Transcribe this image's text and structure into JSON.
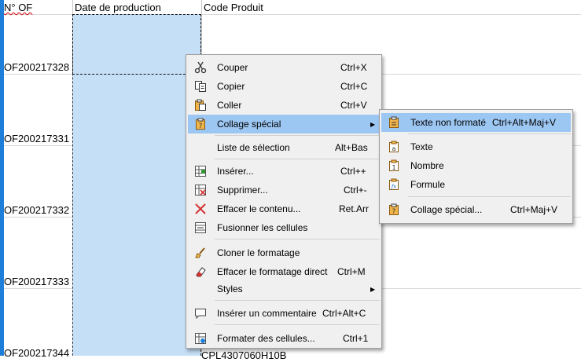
{
  "headers": {
    "of": "N° OF",
    "date": "Date de production",
    "code": "Code Produit"
  },
  "rows": [
    "OF200217328",
    "OF200217331",
    "OF200217332",
    "OF200217333",
    "OF200217344"
  ],
  "code_fragment": "CPL4307060H10B",
  "context_menu": {
    "cut": {
      "label": "Couper",
      "shortcut": "Ctrl+X"
    },
    "copy": {
      "label": "Copier",
      "shortcut": "Ctrl+C"
    },
    "paste": {
      "label": "Coller",
      "shortcut": "Ctrl+V"
    },
    "paste_special": {
      "label": "Collage spécial"
    },
    "selection_list": {
      "label": "Liste de sélection",
      "shortcut": "Alt+Bas"
    },
    "insert": {
      "label": "Insérer...",
      "shortcut": "Ctrl++"
    },
    "delete": {
      "label": "Supprimer...",
      "shortcut": "Ctrl+-"
    },
    "clear": {
      "label": "Effacer le contenu...",
      "shortcut": "Ret.Arr"
    },
    "merge": {
      "label": "Fusionner les cellules"
    },
    "clone": {
      "label": "Cloner le formatage"
    },
    "clear_direct": {
      "label": "Effacer le formatage direct",
      "shortcut": "Ctrl+M"
    },
    "styles": {
      "label": "Styles"
    },
    "comment": {
      "label": "Insérer un commentaire",
      "shortcut": "Ctrl+Alt+C"
    },
    "format_cells": {
      "label": "Formater des cellules...",
      "shortcut": "Ctrl+1"
    }
  },
  "submenu": {
    "unformatted": {
      "label": "Texte non formaté",
      "shortcut": "Ctrl+Alt+Maj+V"
    },
    "text": {
      "label": "Texte"
    },
    "number": {
      "label": "Nombre"
    },
    "formula": {
      "label": "Formule"
    },
    "paste_special": {
      "label": "Collage spécial...",
      "shortcut": "Ctrl+Maj+V"
    }
  }
}
